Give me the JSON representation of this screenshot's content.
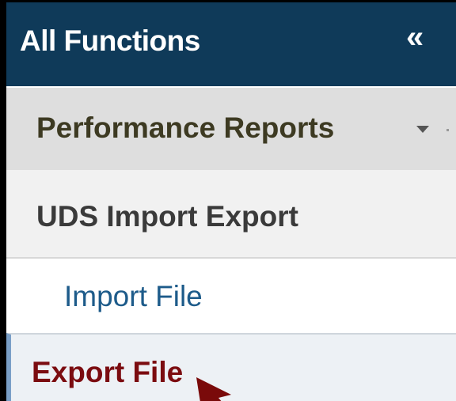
{
  "header": {
    "title": "All Functions",
    "collapse_glyph": "«"
  },
  "menu": {
    "performance_reports": "Performance Reports",
    "uds_import_export": "UDS Import Export",
    "import_file": "Import File",
    "export_file": "Export File"
  },
  "icons": {
    "collapse": "double-chevron-left-icon",
    "dropdown": "caret-down-icon",
    "pointer": "annotation-arrow-icon"
  },
  "colors": {
    "header_bg": "#0f3a59",
    "active_text": "#7b0c10",
    "link_text": "#1d5b8a",
    "active_marker": "#7a9fc7",
    "annotation_arrow": "#7a0a0a"
  }
}
